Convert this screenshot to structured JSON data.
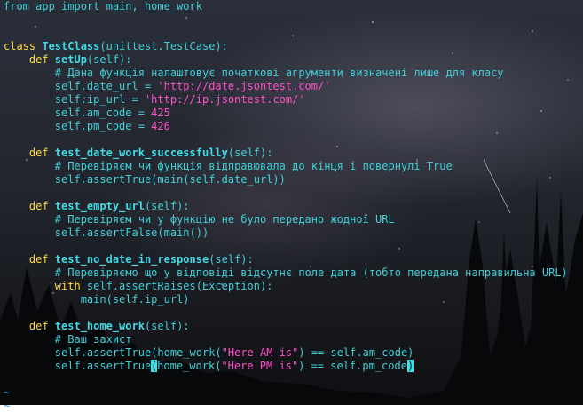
{
  "editor": {
    "lines": [
      [
        {
          "t": "from app import main, home_work",
          "c": "plain"
        }
      ],
      [],
      [],
      [
        {
          "t": "class ",
          "c": "kw"
        },
        {
          "t": "TestClass",
          "c": "fn"
        },
        {
          "t": "(unittest.TestCase):",
          "c": "plain"
        }
      ],
      [
        {
          "t": "    def ",
          "c": "kw"
        },
        {
          "t": "setUp",
          "c": "fn"
        },
        {
          "t": "(self):",
          "c": "plain"
        }
      ],
      [
        {
          "t": "        # Дана функція налаштовує початкові агрументи визначені лише для класу",
          "c": "plain"
        }
      ],
      [
        {
          "t": "        self.date_url = ",
          "c": "plain"
        },
        {
          "t": "'http://date.jsontest.com/'",
          "c": "str"
        }
      ],
      [
        {
          "t": "        self.ip_url = ",
          "c": "plain"
        },
        {
          "t": "'http://ip.jsontest.com/'",
          "c": "str"
        }
      ],
      [
        {
          "t": "        self.am_code = ",
          "c": "plain"
        },
        {
          "t": "425",
          "c": "num"
        }
      ],
      [
        {
          "t": "        self.pm_code = ",
          "c": "plain"
        },
        {
          "t": "426",
          "c": "num"
        }
      ],
      [],
      [
        {
          "t": "    def ",
          "c": "kw"
        },
        {
          "t": "test_date_work_successfully",
          "c": "fn"
        },
        {
          "t": "(self):",
          "c": "plain"
        }
      ],
      [
        {
          "t": "        # Перевіряєм чи функція відправювала до кінця і повернулі True",
          "c": "plain"
        }
      ],
      [
        {
          "t": "        self.assertTrue(main(self.date_url))",
          "c": "plain"
        }
      ],
      [],
      [
        {
          "t": "    def ",
          "c": "kw"
        },
        {
          "t": "test_empty_url",
          "c": "fn"
        },
        {
          "t": "(self):",
          "c": "plain"
        }
      ],
      [
        {
          "t": "        # Перевіряєм чи у функцію не було передано жодної URL",
          "c": "plain"
        }
      ],
      [
        {
          "t": "        self.assertFalse(main())",
          "c": "plain"
        }
      ],
      [],
      [
        {
          "t": "    def ",
          "c": "kw"
        },
        {
          "t": "test_no_date_in_response",
          "c": "fn"
        },
        {
          "t": "(self):",
          "c": "plain"
        }
      ],
      [
        {
          "t": "        # Перевіряємо що у відповіді відсутнє поле дата (тобто передана направильна URL)",
          "c": "plain"
        }
      ],
      [
        {
          "t": "        with ",
          "c": "kw"
        },
        {
          "t": "self.assertRaises(Exception):",
          "c": "plain"
        }
      ],
      [
        {
          "t": "            main(self.ip_url)",
          "c": "plain"
        }
      ],
      [],
      [
        {
          "t": "    def ",
          "c": "kw"
        },
        {
          "t": "test_home_work",
          "c": "fn"
        },
        {
          "t": "(self):",
          "c": "plain"
        }
      ],
      [
        {
          "t": "        # Ваш захист",
          "c": "plain"
        }
      ],
      [
        {
          "t": "        self.assertTrue(home_work(",
          "c": "plain"
        },
        {
          "t": "\"Here AM is\"",
          "c": "str"
        },
        {
          "t": ") == self.am_code)",
          "c": "plain"
        }
      ],
      [
        {
          "t": "        self.assertTrue",
          "c": "plain"
        },
        {
          "t": "(",
          "c": "cursor"
        },
        {
          "t": "home_work(",
          "c": "plain"
        },
        {
          "t": "\"Here PM is\"",
          "c": "str"
        },
        {
          "t": ") == self.pm_code",
          "c": "plain"
        },
        {
          "t": ")",
          "c": "cursor"
        }
      ],
      [],
      [
        {
          "t": "~",
          "c": "tilde"
        }
      ],
      [
        {
          "t": "~",
          "c": "tilde"
        }
      ]
    ]
  }
}
